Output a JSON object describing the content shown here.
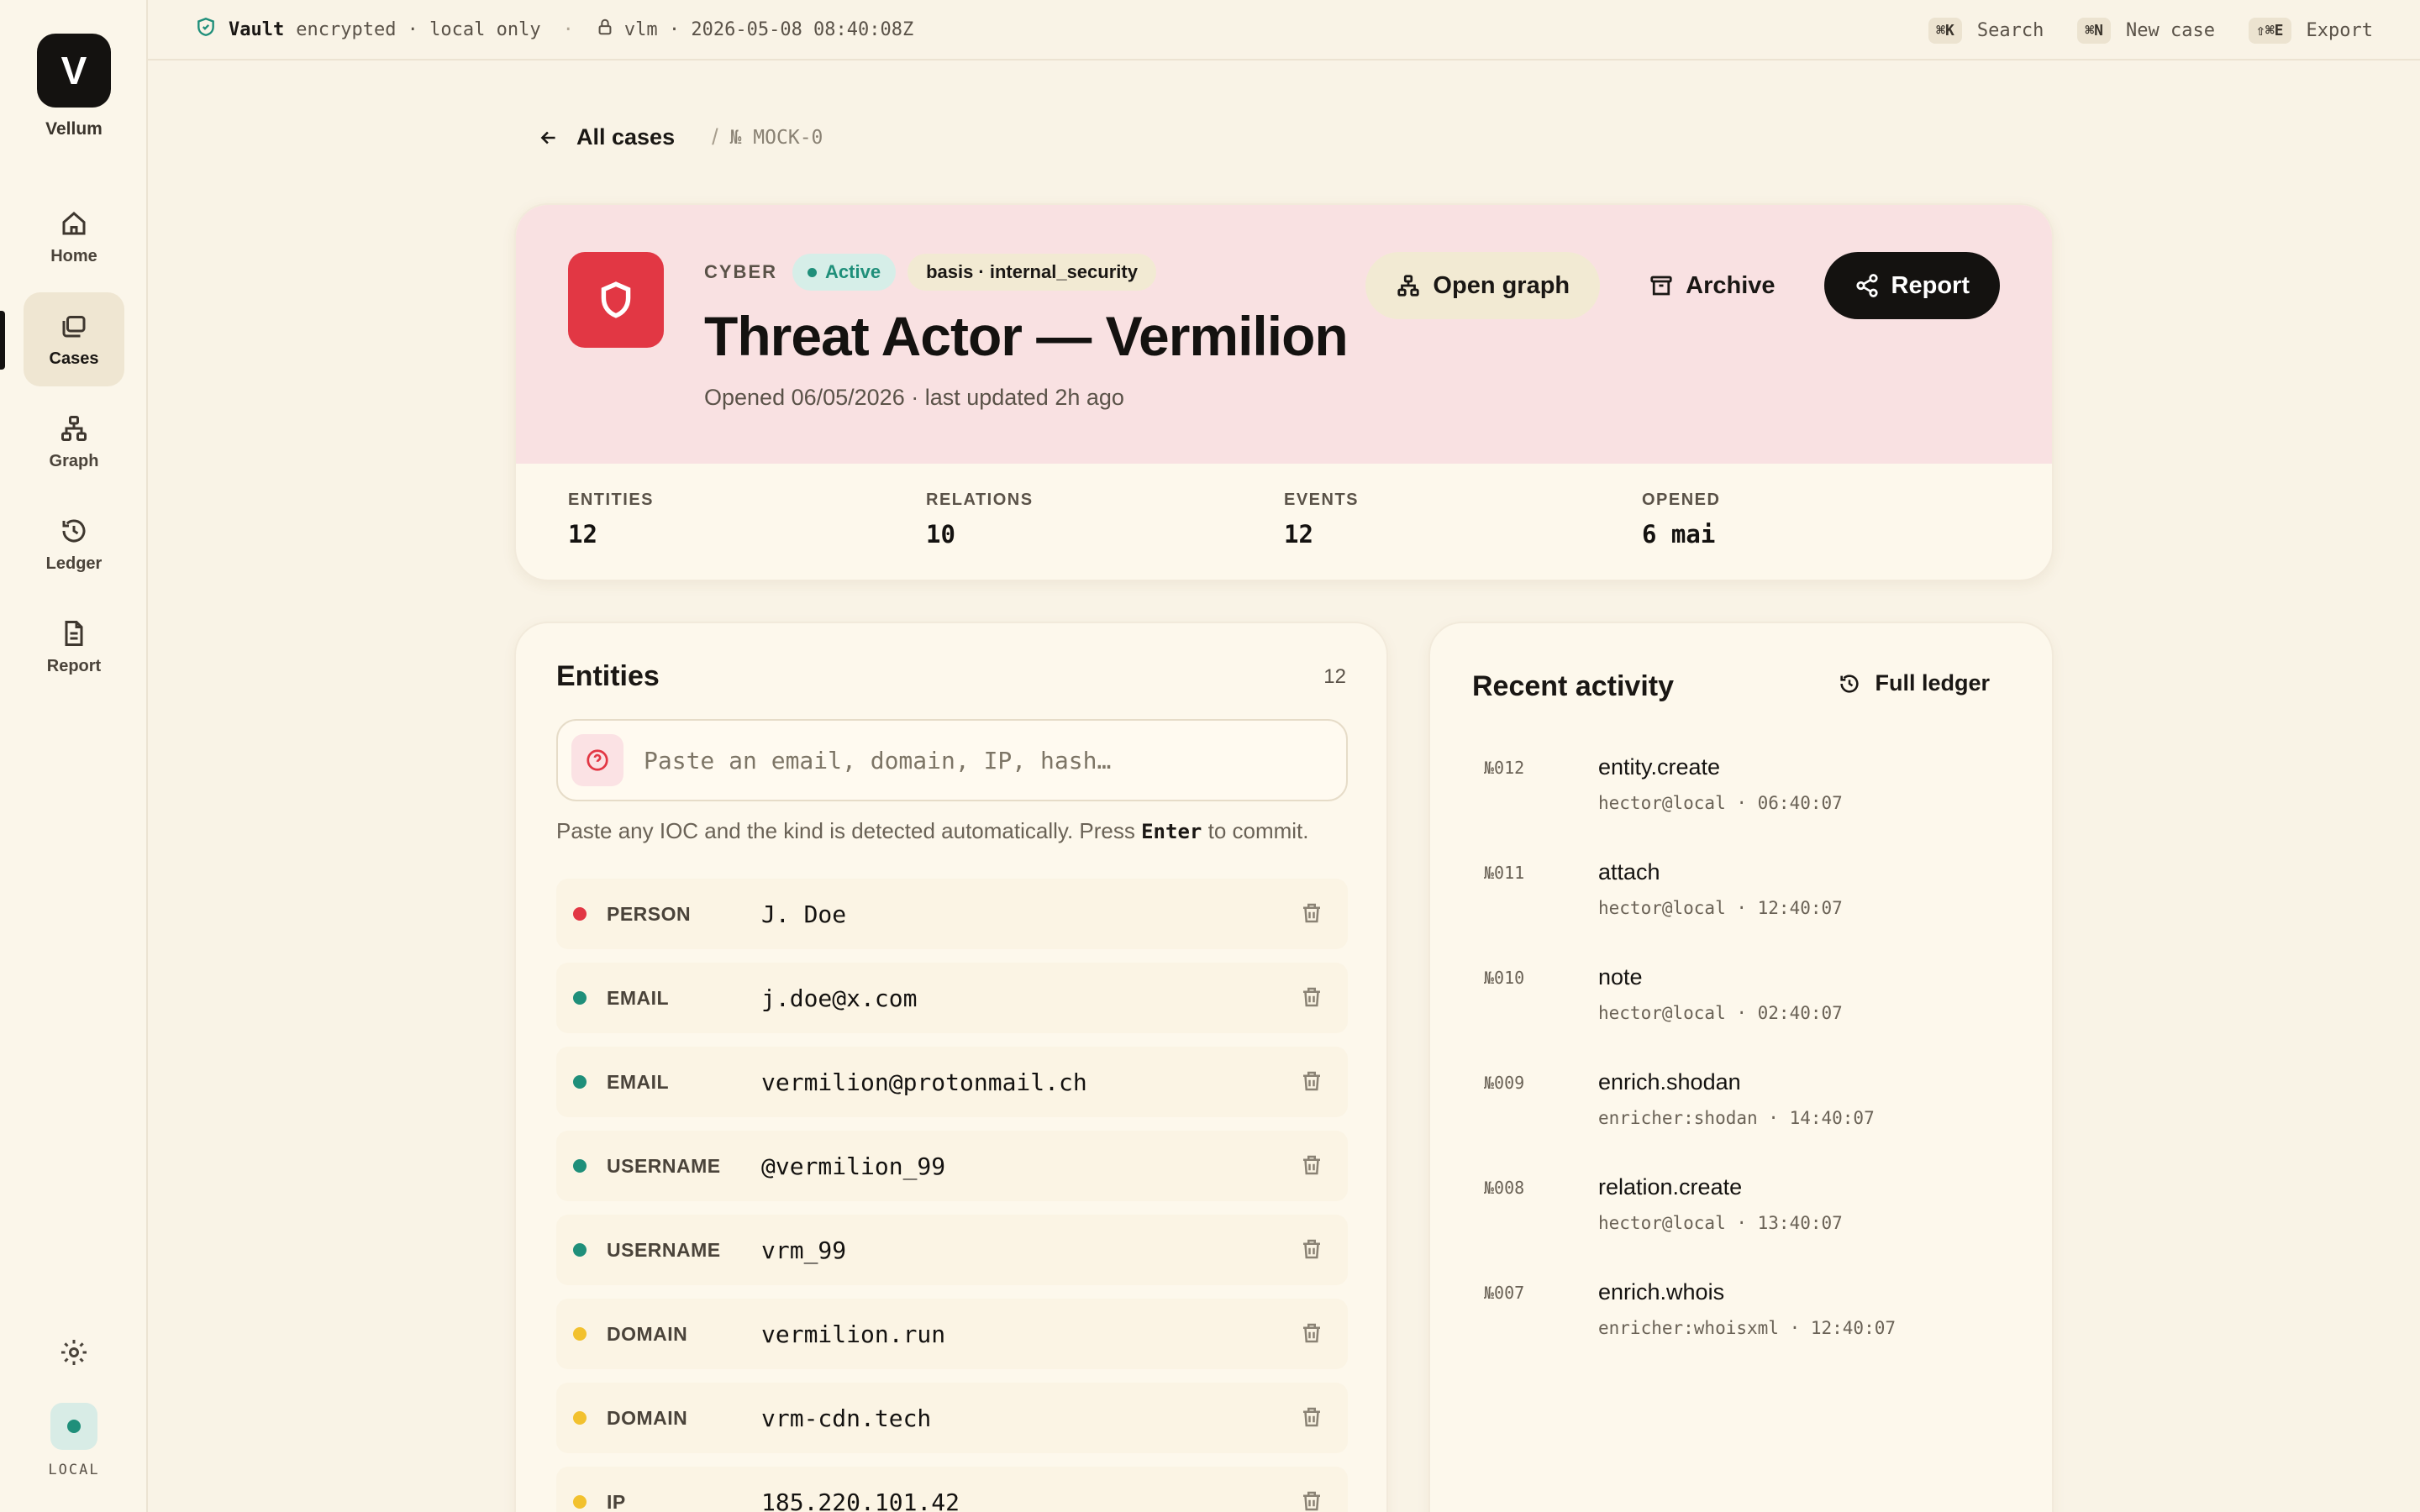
{
  "app": {
    "logo_letter": "V",
    "name": "Vellum"
  },
  "nav": [
    {
      "label": "Home",
      "icon": "home-icon"
    },
    {
      "label": "Cases",
      "icon": "folders-icon",
      "active": true
    },
    {
      "label": "Graph",
      "icon": "graph-icon"
    },
    {
      "label": "Ledger",
      "icon": "history-icon"
    },
    {
      "label": "Report",
      "icon": "document-icon"
    }
  ],
  "sidebar_footer": {
    "local_label": "LOCAL"
  },
  "topbar": {
    "vault": "Vault",
    "vault_status": "encrypted · local only",
    "sep": "·",
    "session": "vlm · 2026-05-08 08:40:08Z",
    "shortcuts": [
      {
        "key": "⌘K",
        "label": "Search"
      },
      {
        "key": "⌘N",
        "label": "New case"
      },
      {
        "key": "⇧⌘E",
        "label": "Export"
      }
    ]
  },
  "breadcrumb": {
    "back": "All cases",
    "slash": "/",
    "case_id": "№ MOCK-0"
  },
  "case": {
    "type": "CYBER",
    "status": "Active",
    "basis": "basis · internal_security",
    "title": "Threat Actor — Vermilion",
    "subtitle": "Opened 06/05/2026 · last updated 2h ago",
    "actions": {
      "graph": "Open graph",
      "archive": "Archive",
      "report": "Report"
    },
    "stats": [
      {
        "label": "ENTITIES",
        "value": "12"
      },
      {
        "label": "RELATIONS",
        "value": "10"
      },
      {
        "label": "EVENTS",
        "value": "12"
      },
      {
        "label": "OPENED",
        "value": "6 mai"
      }
    ]
  },
  "entities": {
    "title": "Entities",
    "count": "12",
    "input_placeholder": "Paste an email, domain, IP, hash…",
    "hint_before": "Paste any IOC and the kind is detected automatically. Press",
    "hint_key": "Enter",
    "hint_after": "to commit.",
    "colors": {
      "person": "#e23744",
      "contact": "#1f8f7a",
      "infra": "#f2c12e"
    },
    "rows": [
      {
        "kind": "PERSON",
        "value": "J. Doe",
        "color": "#e23744"
      },
      {
        "kind": "EMAIL",
        "value": "j.doe@x.com",
        "color": "#1f8f7a"
      },
      {
        "kind": "EMAIL",
        "value": "vermilion@protonmail.ch",
        "color": "#1f8f7a"
      },
      {
        "kind": "USERNAME",
        "value": "@vermilion_99",
        "color": "#1f8f7a"
      },
      {
        "kind": "USERNAME",
        "value": "vrm_99",
        "color": "#1f8f7a"
      },
      {
        "kind": "DOMAIN",
        "value": "vermilion.run",
        "color": "#f2c12e"
      },
      {
        "kind": "DOMAIN",
        "value": "vrm-cdn.tech",
        "color": "#f2c12e"
      },
      {
        "kind": "IP",
        "value": "185.220.101.42",
        "color": "#f2c12e"
      }
    ]
  },
  "activity": {
    "title": "Recent activity",
    "full_ledger": "Full ledger",
    "items": [
      {
        "no": "№012",
        "title": "entity.create",
        "meta": "hector@local · 06:40:07"
      },
      {
        "no": "№011",
        "title": "attach",
        "meta": "hector@local · 12:40:07"
      },
      {
        "no": "№010",
        "title": "note",
        "meta": "hector@local · 02:40:07"
      },
      {
        "no": "№009",
        "title": "enrich.shodan",
        "meta": "enricher:shodan · 14:40:07"
      },
      {
        "no": "№008",
        "title": "relation.create",
        "meta": "hector@local · 13:40:07"
      },
      {
        "no": "№007",
        "title": "enrich.whois",
        "meta": "enricher:whoisxml · 12:40:07"
      }
    ]
  }
}
